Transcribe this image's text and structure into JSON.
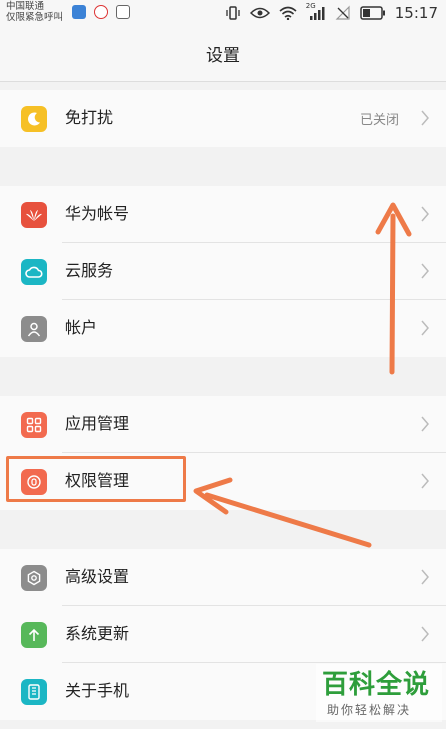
{
  "status_bar": {
    "carrier_line1": "中国联通",
    "carrier_line2": "仅限紧急呼叫",
    "network": "2G",
    "time": "15:17"
  },
  "header": {
    "title": "设置"
  },
  "settings": {
    "dnd": {
      "label": "免打扰",
      "value": "已关闭",
      "icon": "moon-icon",
      "icon_color": "#f6c026"
    },
    "huawei_account": {
      "label": "华为帐号",
      "icon": "huawei-logo-icon",
      "icon_color": "#e7513d"
    },
    "cloud": {
      "label": "云服务",
      "icon": "cloud-icon",
      "icon_color": "#1bb6c4"
    },
    "accounts": {
      "label": "帐户",
      "icon": "person-icon",
      "icon_color": "#8c8c8c"
    },
    "apps": {
      "label": "应用管理",
      "icon": "grid-icon",
      "icon_color": "#f26a4f"
    },
    "permissions": {
      "label": "权限管理",
      "icon": "shield-icon",
      "icon_color": "#f26a4f"
    },
    "advanced": {
      "label": "高级设置",
      "icon": "gear-icon",
      "icon_color": "#8c8c8c"
    },
    "update": {
      "label": "系统更新",
      "icon": "upload-arrow-icon",
      "icon_color": "#57b85a"
    },
    "about": {
      "label": "关于手机",
      "icon": "phone-icon",
      "icon_color": "#1bb6c4"
    }
  },
  "annotation": {
    "highlight_color": "#ee7a48"
  },
  "watermark": {
    "title": "百科全说",
    "subtitle": "助你轻松解决"
  }
}
